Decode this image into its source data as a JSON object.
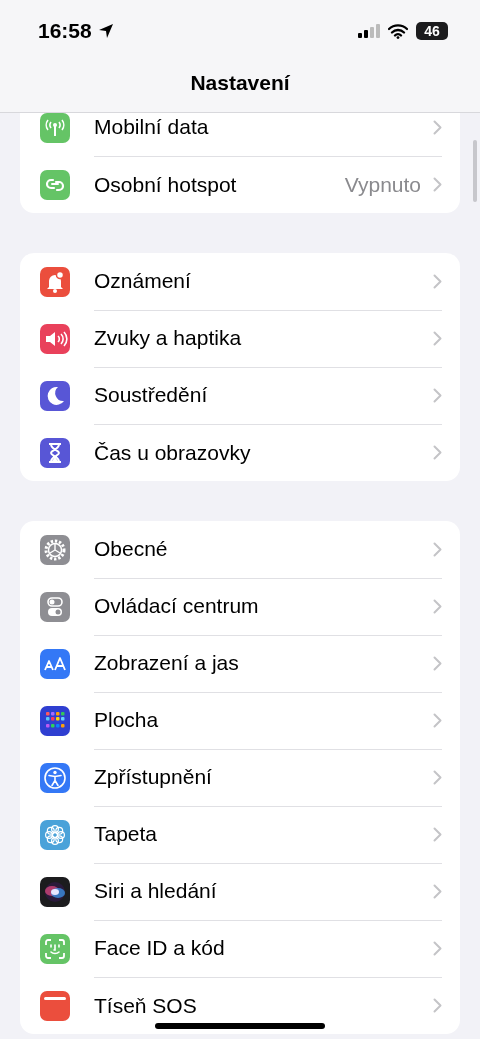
{
  "status_bar": {
    "time": "16:58",
    "battery": "46"
  },
  "title": "Nastavení",
  "groups": [
    {
      "items": [
        {
          "kind": "antenna",
          "label": "Mobilní data"
        },
        {
          "kind": "hotspot",
          "label": "Osobní hotspot",
          "value": "Vypnuto"
        }
      ]
    },
    {
      "items": [
        {
          "kind": "bell",
          "label": "Oznámení"
        },
        {
          "kind": "speaker",
          "label": "Zvuky a haptika"
        },
        {
          "kind": "moon",
          "label": "Soustředění"
        },
        {
          "kind": "hourglass",
          "label": "Čas u obrazovky"
        }
      ]
    },
    {
      "items": [
        {
          "kind": "gear",
          "label": "Obecné"
        },
        {
          "kind": "switches",
          "label": "Ovládací centrum"
        },
        {
          "kind": "textsize",
          "label": "Zobrazení a jas"
        },
        {
          "kind": "grid",
          "label": "Plocha"
        },
        {
          "kind": "accessibility",
          "label": "Zpřístupnění"
        },
        {
          "kind": "flower",
          "label": "Tapeta"
        },
        {
          "kind": "orb",
          "label": "Siri a hledání"
        },
        {
          "kind": "face",
          "label": "Face ID a kód"
        },
        {
          "kind": "sos",
          "label": "Tíseň SOS"
        }
      ]
    }
  ]
}
